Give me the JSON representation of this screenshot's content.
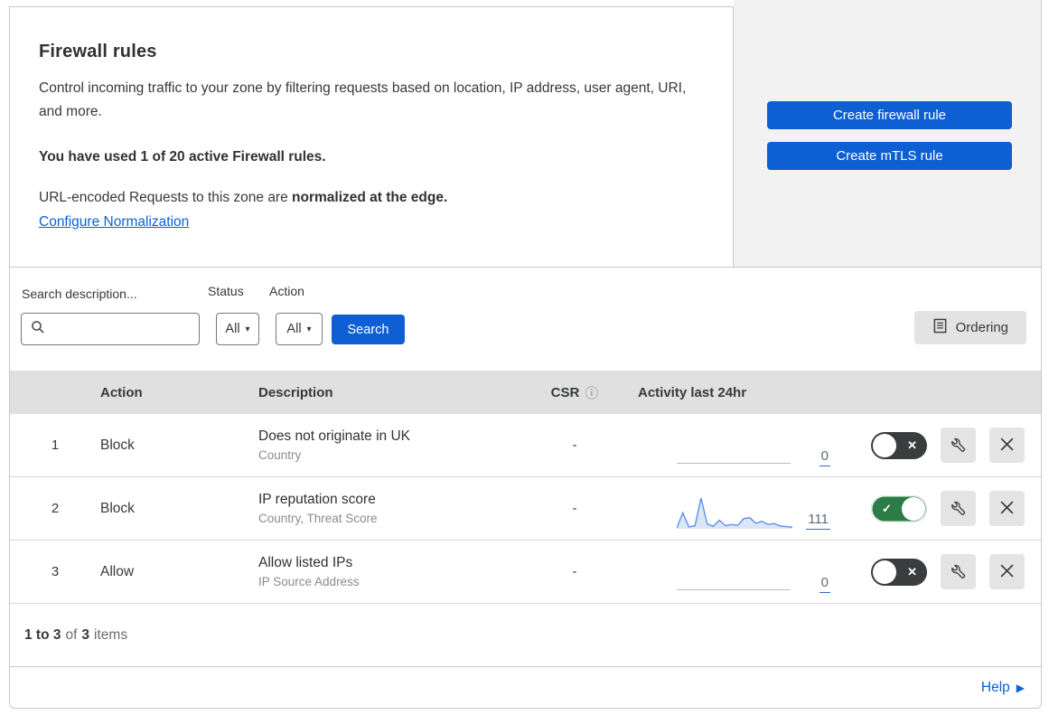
{
  "colors": {
    "accent_blue": "#0d5fd3",
    "toggle_on_green": "#2b7c45",
    "toggle_off_gray": "#3a3d3e",
    "panel_gray": "#f2f2f2",
    "table_header_gray": "#e0e0e0",
    "sparkline_blue": "#5f8fe8"
  },
  "header": {
    "title": "Firewall rules",
    "description": "Control incoming traffic to your zone by filtering requests based on location, IP address, user agent, URI, and more.",
    "usage": "You have used 1 of 20 active Firewall rules.",
    "normalization_text": "URL-encoded Requests to this zone are ",
    "normalization_bold": "normalized at the edge.",
    "normalization_link": "Configure Normalization"
  },
  "actions_panel": {
    "create_firewall_label": "Create firewall rule",
    "create_mtls_label": "Create mTLS rule"
  },
  "filters": {
    "search_label": "Search description...",
    "status_label": "Status",
    "status_value": "All",
    "action_label": "Action",
    "action_value": "All",
    "search_button": "Search",
    "ordering_button": "Ordering"
  },
  "table": {
    "columns": {
      "action": "Action",
      "description": "Description",
      "csr": "CSR",
      "activity": "Activity last 24hr"
    },
    "info_icon": "ⓘ",
    "rows": [
      {
        "index": "1",
        "action": "Block",
        "description": "Does not originate in UK",
        "criteria": "Country",
        "csr": "-",
        "count": "0",
        "enabled": false
      },
      {
        "index": "2",
        "action": "Block",
        "description": "IP reputation score",
        "criteria": "Country, Threat Score",
        "csr": "-",
        "count": "111",
        "enabled": true
      },
      {
        "index": "3",
        "action": "Allow",
        "description": "Allow listed IPs",
        "criteria": "IP Source Address",
        "csr": "-",
        "count": "0",
        "enabled": false
      }
    ]
  },
  "chart_data": {
    "type": "area",
    "title": "Activity last 24hr sparkline (rule 2, total 111 events)",
    "xlabel": "",
    "ylabel": "",
    "ylim": [
      0,
      100
    ],
    "values": [
      2,
      52,
      6,
      10,
      100,
      16,
      8,
      28,
      10,
      14,
      11,
      33,
      36,
      18,
      24,
      14,
      17,
      9,
      7,
      5
    ]
  },
  "footer": {
    "range_bold": "1 to 3",
    "of_text": "of",
    "total_bold": "3",
    "items_text": "items",
    "help_label": "Help",
    "help_arrow": "▶"
  },
  "glyphs": {
    "caret_down": "▾",
    "toggle_off_x": "✕",
    "toggle_on_check": "✓"
  }
}
